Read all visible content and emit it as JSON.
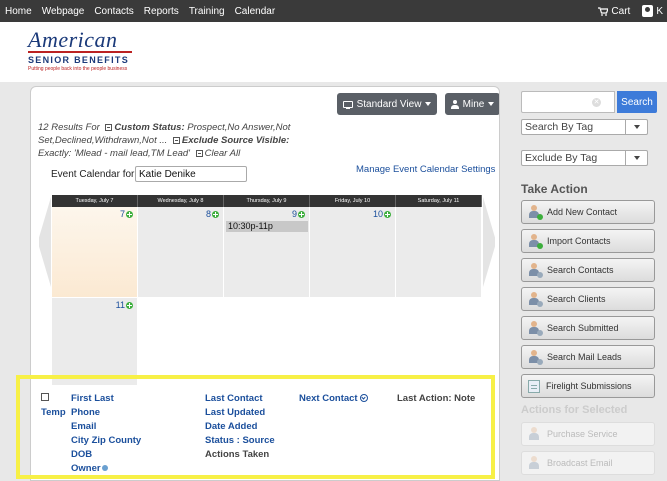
{
  "topnav": {
    "items": [
      "Home",
      "Webpage",
      "Contacts",
      "Reports",
      "Training",
      "Calendar"
    ],
    "cart_label": "Cart",
    "user_initial": "K"
  },
  "logo": {
    "script": "American",
    "name": "SENIOR BENEFITS",
    "tagline": "Putting people back into the people business"
  },
  "toolbar": {
    "standard_view_label": "Standard View",
    "mine_label": "Mine"
  },
  "results": {
    "line1_prefix": "12 Results For",
    "custom_status_label": "Custom Status:",
    "custom_status_value": " Prospect,No Answer,Not Set,Declined,Withdrawn,Not ...",
    "exclude_label": "Exclude Source Visible:",
    "exclude_value": " Exactly: 'Mlead - mail lead,TM Lead'",
    "clear_all": "Clear All"
  },
  "calendar": {
    "for_label": "Event Calendar for",
    "for_value": "Katie Denike",
    "manage_link": "Manage Event Calendar Settings",
    "day_headers": [
      "Tuesday, July 7",
      "Wednesday, July 8",
      "Thursday, July 9",
      "Friday, July 10",
      "Saturday, July 11"
    ],
    "day_numbers": [
      "7",
      "8",
      "9",
      "10",
      "",
      "11"
    ],
    "event_label": "10:30p-11p"
  },
  "list_header": {
    "temp": "Temp",
    "first_last": "First Last",
    "phone": "Phone",
    "email": "Email",
    "city_zip_county": "City Zip County",
    "dob": "DOB",
    "owner": "Owner",
    "last_contact": "Last Contact",
    "last_updated": "Last Updated",
    "date_added": "Date Added",
    "status_source": "Status : Source",
    "actions_taken": "Actions Taken",
    "next_contact": "Next Contact",
    "last_action_note": "Last Action: Note"
  },
  "sidebar": {
    "search_placeholder": "",
    "search_button": "Search",
    "search_by_tag": "Search By Tag",
    "exclude_by_tag": "Exclude By Tag",
    "take_action_title": "Take Action",
    "actions": [
      "Add New Contact",
      "Import Contacts",
      "Search Contacts",
      "Search Clients",
      "Search Submitted",
      "Search Mail Leads",
      "Firelight Submissions"
    ],
    "actions_for_selected_title": "Actions for Selected",
    "selected_actions": [
      "Purchase Service",
      "Broadcast Email"
    ]
  },
  "colors": {
    "highlight": "#f7f046",
    "link": "#1b4f9c",
    "search_button": "#3d7bd9"
  }
}
